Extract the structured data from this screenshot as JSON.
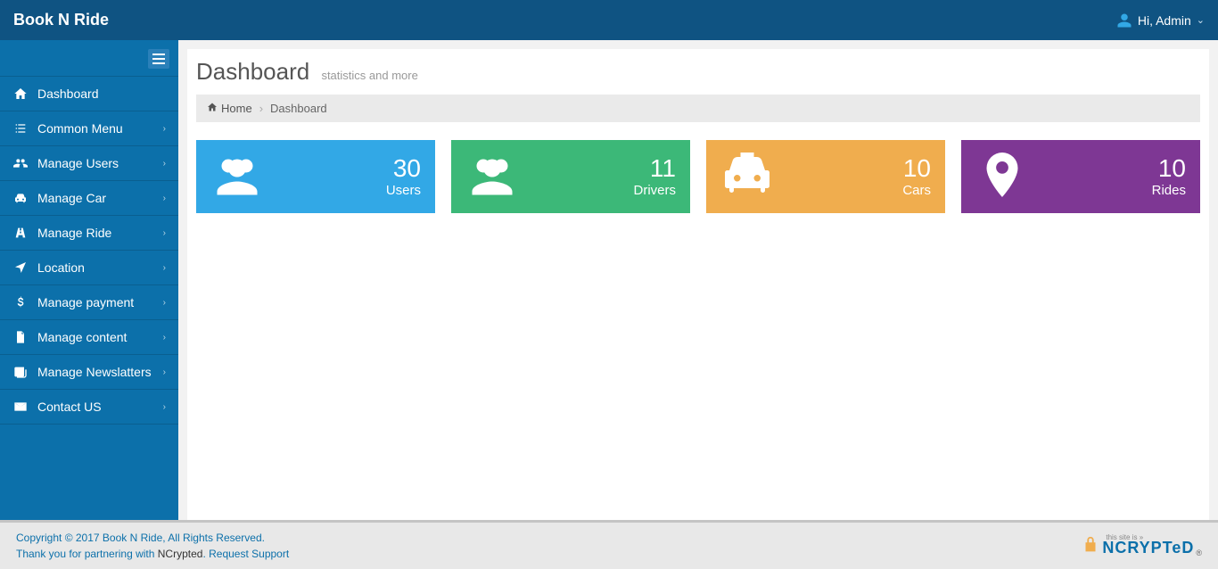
{
  "brand": "Book N Ride",
  "user": {
    "greeting": "Hi, Admin"
  },
  "sidebar": {
    "items": [
      {
        "label": "Dashboard",
        "expandable": false
      },
      {
        "label": "Common Menu",
        "expandable": true
      },
      {
        "label": "Manage Users",
        "expandable": true
      },
      {
        "label": "Manage Car",
        "expandable": true
      },
      {
        "label": "Manage Ride",
        "expandable": true
      },
      {
        "label": "Location",
        "expandable": true
      },
      {
        "label": "Manage payment",
        "expandable": true
      },
      {
        "label": "Manage content",
        "expandable": true
      },
      {
        "label": "Manage Newslatters",
        "expandable": true
      },
      {
        "label": "Contact US",
        "expandable": true
      }
    ]
  },
  "page": {
    "title": "Dashboard",
    "subtitle": "statistics and more"
  },
  "breadcrumb": {
    "home": "Home",
    "current": "Dashboard"
  },
  "cards": [
    {
      "value": "30",
      "label": "Users"
    },
    {
      "value": "11",
      "label": "Drivers"
    },
    {
      "value": "10",
      "label": "Cars"
    },
    {
      "value": "10",
      "label": "Rides"
    }
  ],
  "footer": {
    "line1": "Copyright © 2017 Book N Ride, All Rights Reserved.",
    "line2_pre": "Thank you for partnering with ",
    "line2_link1": "NCrypted",
    "line2_mid": ". ",
    "line2_link2": "Request Support",
    "seal_top": "this site is »",
    "seal_text": "NCRYPTeD",
    "seal_reg": "®"
  }
}
